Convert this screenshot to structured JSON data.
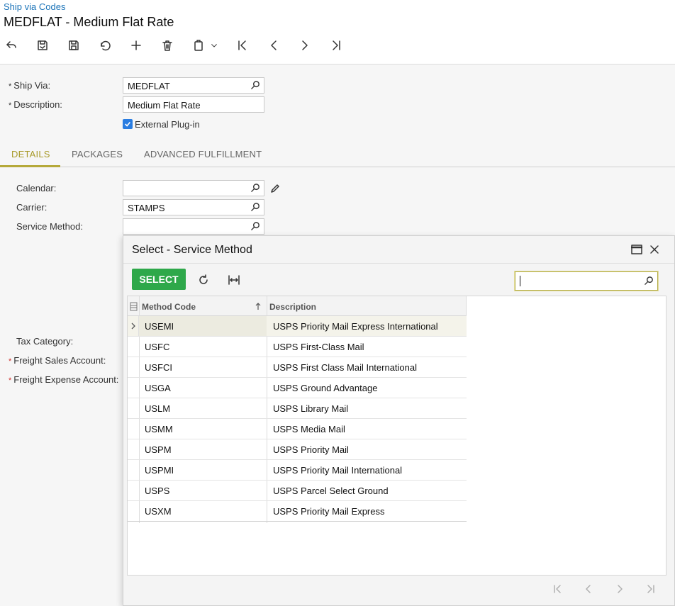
{
  "header": {
    "breadcrumb": "Ship via Codes",
    "title": "MEDFLAT - Medium Flat Rate"
  },
  "form": {
    "ship_via_label": "Ship Via:",
    "ship_via_value": "MEDFLAT",
    "description_label": "Description:",
    "description_value": "Medium Flat Rate",
    "external_plugin_label": "External Plug-in",
    "external_plugin_checked": true
  },
  "tabs": [
    {
      "label": "DETAILS",
      "active": true
    },
    {
      "label": "PACKAGES",
      "active": false
    },
    {
      "label": "ADVANCED FULFILLMENT",
      "active": false
    }
  ],
  "details": {
    "calendar_label": "Calendar:",
    "calendar_value": "",
    "carrier_label": "Carrier:",
    "carrier_value": "STAMPS",
    "service_method_label": "Service Method:",
    "service_method_value": "",
    "tax_category_label": "Tax Category:",
    "freight_sales_label": "Freight Sales Account:",
    "freight_expense_label": "Freight Expense Account:"
  },
  "dialog": {
    "title": "Select - Service Method",
    "select_label": "SELECT",
    "search_value": "",
    "columns": [
      "Method Code",
      "Description"
    ],
    "rows": [
      {
        "code": "USEMI",
        "description": "USPS Priority Mail Express International"
      },
      {
        "code": "USFC",
        "description": "USPS First-Class Mail"
      },
      {
        "code": "USFCI",
        "description": "USPS First Class Mail International"
      },
      {
        "code": "USGA",
        "description": "USPS Ground Advantage"
      },
      {
        "code": "USLM",
        "description": "USPS Library Mail"
      },
      {
        "code": "USMM",
        "description": "USPS Media Mail"
      },
      {
        "code": "USPM",
        "description": "USPS Priority Mail"
      },
      {
        "code": "USPMI",
        "description": "USPS Priority Mail International"
      },
      {
        "code": "USPS",
        "description": "USPS Parcel Select Ground"
      },
      {
        "code": "USXM",
        "description": "USPS Priority Mail Express"
      }
    ]
  },
  "colors": {
    "accent_tab": "#a89a2a",
    "select_button": "#2ea84a",
    "link": "#1a73b8",
    "checkbox": "#2a7de1"
  }
}
